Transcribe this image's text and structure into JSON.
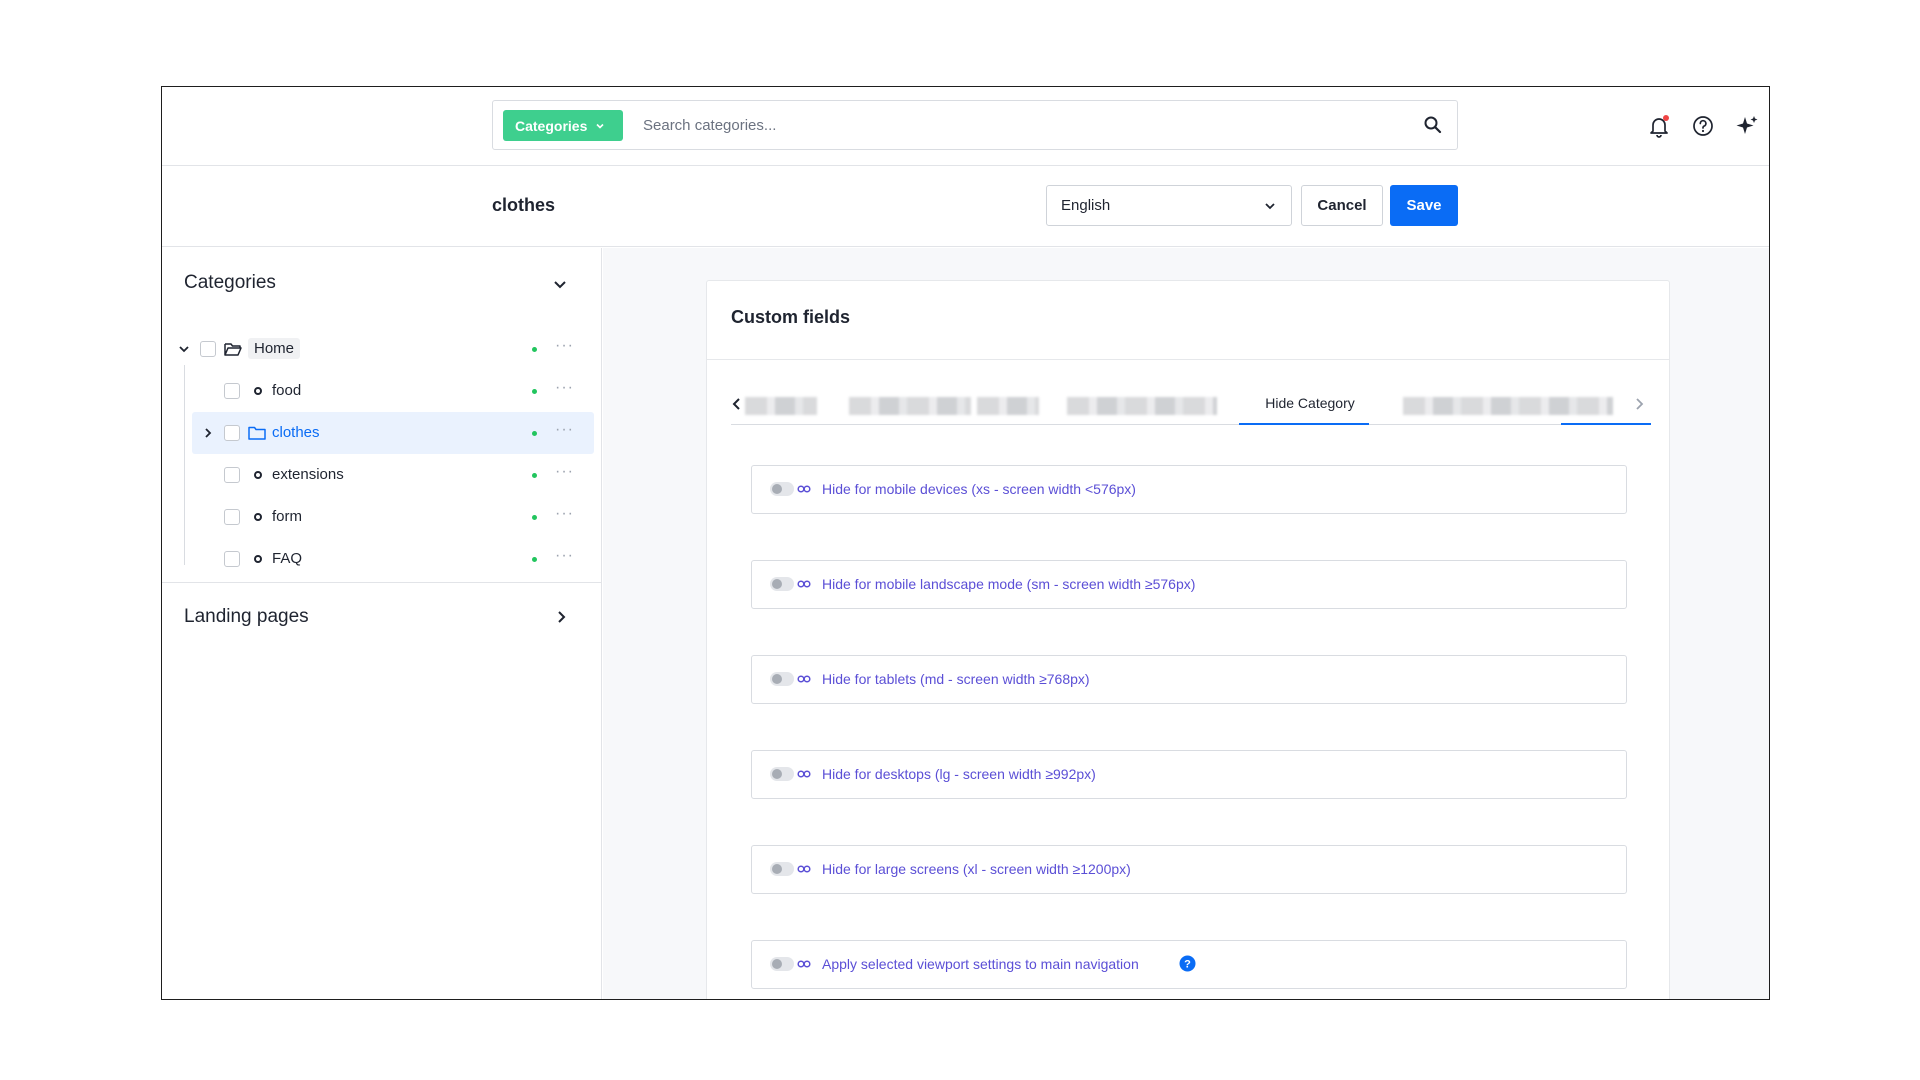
{
  "topbar": {
    "category_button": "Categories",
    "search_placeholder": "Search categories..."
  },
  "header": {
    "title": "clothes",
    "language": "English",
    "cancel_label": "Cancel",
    "save_label": "Save"
  },
  "sidebar": {
    "title": "Categories",
    "tree": [
      {
        "label": "Home",
        "type": "folder-open"
      },
      {
        "label": "food",
        "type": "leaf"
      },
      {
        "label": "clothes",
        "type": "folder",
        "selected": true
      },
      {
        "label": "extensions",
        "type": "leaf"
      },
      {
        "label": "form",
        "type": "leaf"
      },
      {
        "label": "FAQ",
        "type": "leaf"
      }
    ],
    "landing_title": "Landing pages"
  },
  "main": {
    "card_title": "Custom fields",
    "active_tab": "Hide Category",
    "fields": [
      "Hide for mobile devices (xs - screen width <576px)",
      "Hide for mobile landscape mode (sm - screen width ≥576px)",
      "Hide for tablets (md - screen width ≥768px)",
      "Hide for desktops (lg - screen width ≥992px)",
      "Hide for large screens (xl - screen width ≥1200px)",
      "Apply selected viewport settings to main navigation"
    ]
  },
  "colors": {
    "accent_green": "#3ecf8e",
    "primary_blue": "#0a6cf5",
    "label_purple": "#5b4fd6",
    "status_green": "#22c55e",
    "notification_red": "#ef4444"
  }
}
